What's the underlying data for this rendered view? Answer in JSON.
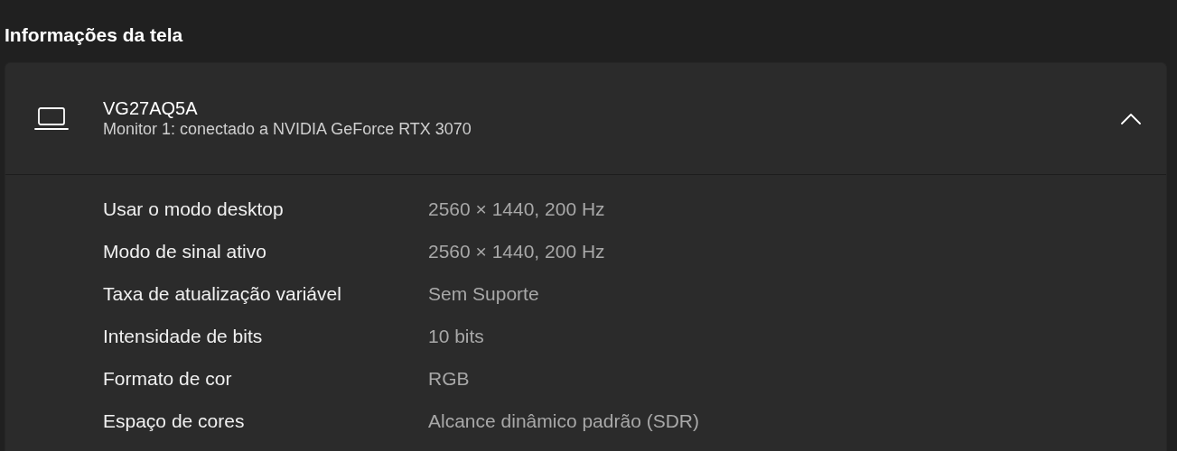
{
  "section_title": "Informações da tela",
  "display": {
    "name": "VG27AQ5A",
    "subtitle": "Monitor 1: conectado a NVIDIA GeForce RTX 3070",
    "expanded": true
  },
  "properties": [
    {
      "label": "Usar o modo desktop",
      "value": "2560 × 1440, 200 Hz"
    },
    {
      "label": "Modo de sinal ativo",
      "value": "2560 × 1440, 200 Hz"
    },
    {
      "label": "Taxa de atualização variável",
      "value": "Sem Suporte"
    },
    {
      "label": "Intensidade de bits",
      "value": "10 bits"
    },
    {
      "label": "Formato de cor",
      "value": "RGB"
    },
    {
      "label": "Espaço de cores",
      "value": "Alcance dinâmico padrão (SDR)"
    }
  ]
}
